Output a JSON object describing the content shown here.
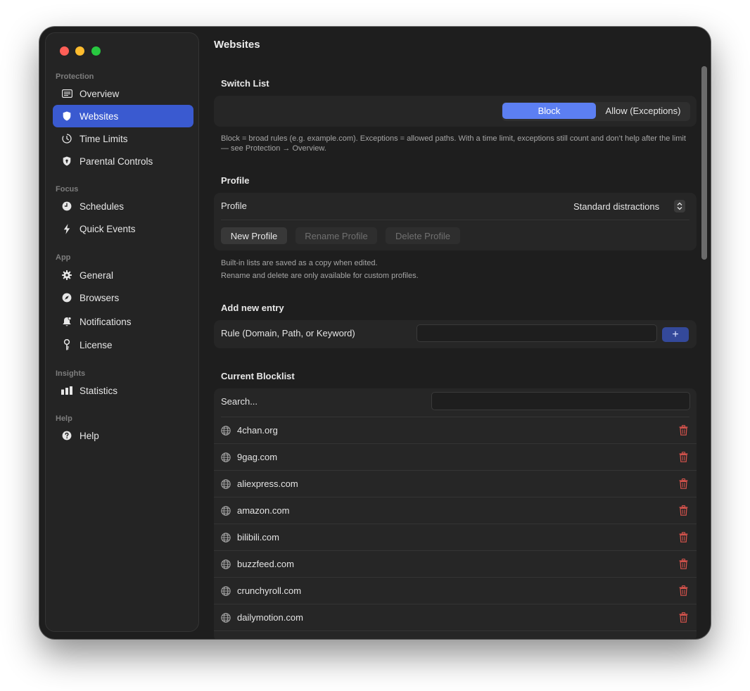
{
  "sidebar": {
    "sections": [
      {
        "title": "Protection",
        "items": [
          {
            "label": "Overview",
            "icon": "overview-icon"
          },
          {
            "label": "Websites",
            "icon": "shield-icon",
            "active": true
          },
          {
            "label": "Time Limits",
            "icon": "timer-icon"
          },
          {
            "label": "Parental Controls",
            "icon": "shield-lock-icon"
          }
        ]
      },
      {
        "title": "Focus",
        "items": [
          {
            "label": "Schedules",
            "icon": "clock-icon"
          },
          {
            "label": "Quick Events",
            "icon": "bolt-icon"
          }
        ]
      },
      {
        "title": "App",
        "items": [
          {
            "label": "General",
            "icon": "gear-icon"
          },
          {
            "label": "Browsers",
            "icon": "compass-icon"
          },
          {
            "label": "Notifications",
            "icon": "bell-icon"
          },
          {
            "label": "License",
            "icon": "key-icon"
          }
        ]
      },
      {
        "title": "Insights",
        "items": [
          {
            "label": "Statistics",
            "icon": "bar-chart-icon"
          }
        ]
      },
      {
        "title": "Help",
        "items": [
          {
            "label": "Help",
            "icon": "help-icon"
          }
        ]
      }
    ]
  },
  "main": {
    "title": "Websites",
    "switch_list": {
      "heading": "Switch List",
      "block_label": "Block",
      "allow_label": "Allow (Exceptions)",
      "selected": "Block",
      "note": "Block = broad rules (e.g. example.com). Exceptions = allowed paths. With a time limit, exceptions still count and don’t help after the limit — see Protection → Overview."
    },
    "profile": {
      "heading": "Profile",
      "label": "Profile",
      "value": "Standard distractions",
      "new_label": "New Profile",
      "rename_label": "Rename Profile",
      "delete_label": "Delete Profile",
      "note_line1": "Built-in lists are saved as a copy when edited.",
      "note_line2": "Rename and delete are only available for custom profiles."
    },
    "add_entry": {
      "heading": "Add new entry",
      "label": "Rule (Domain, Path, or Keyword)",
      "value": "",
      "add_symbol": "+"
    },
    "blocklist": {
      "heading": "Current Blocklist",
      "search_label": "Search...",
      "search_value": "",
      "items": [
        "4chan.org",
        "9gag.com",
        "aliexpress.com",
        "amazon.com",
        "bilibili.com",
        "buzzfeed.com",
        "crunchyroll.com",
        "dailymotion.com"
      ]
    }
  },
  "colors": {
    "accent": "#3a5ad0",
    "segment_selected": "#5c7ff2",
    "delete_red": "#d9544d",
    "window_bg": "#1e1e1e"
  }
}
